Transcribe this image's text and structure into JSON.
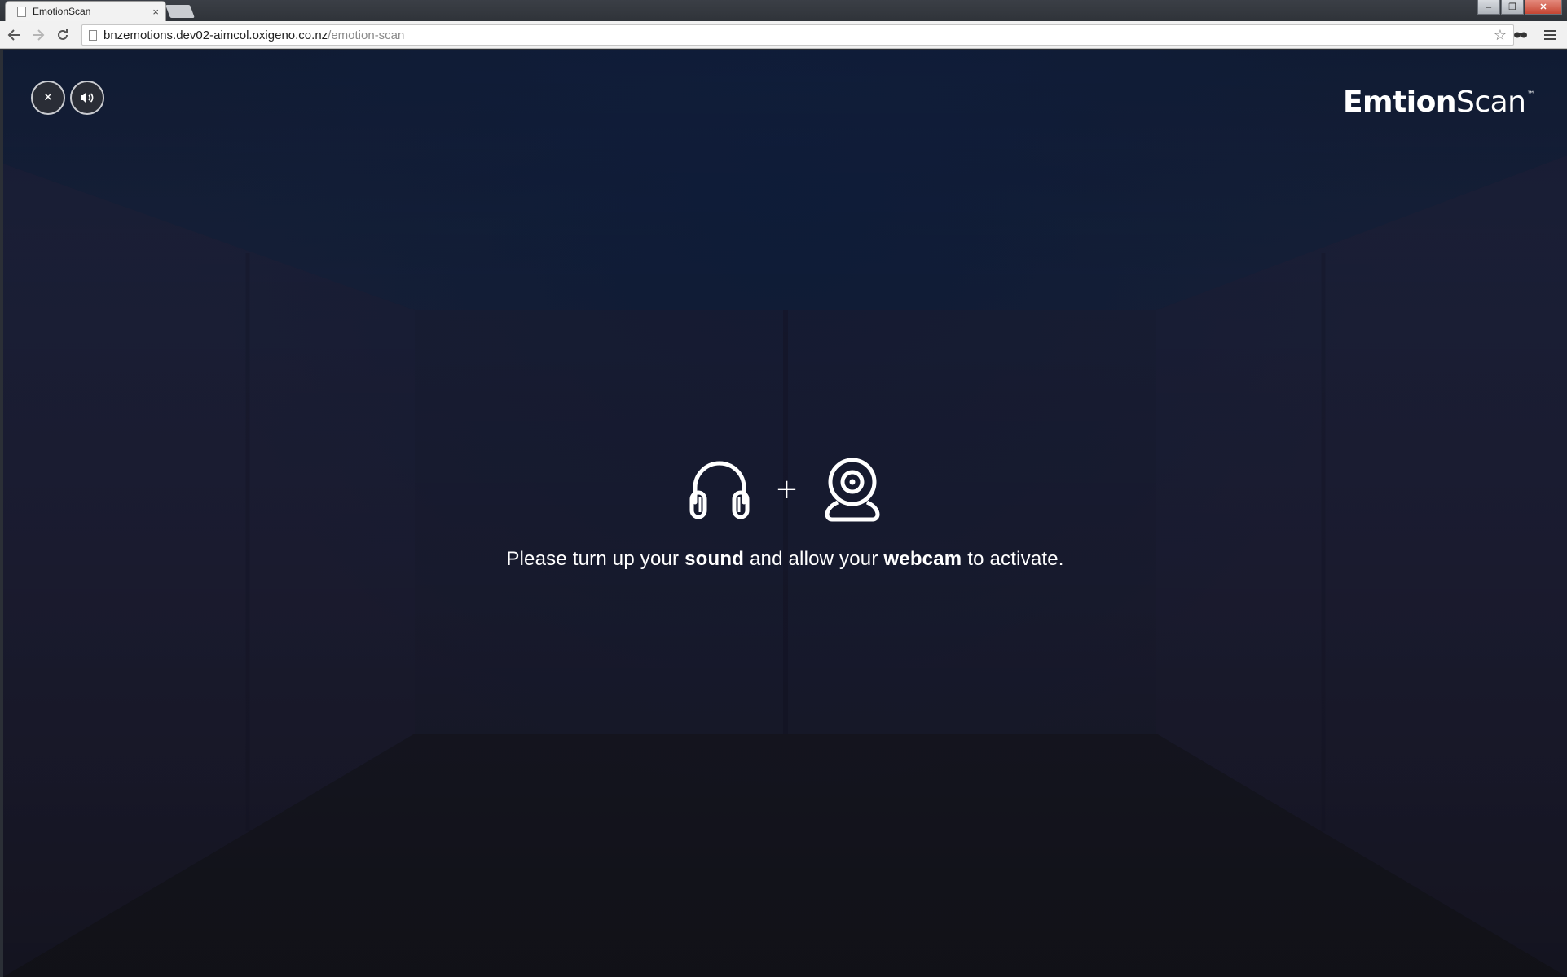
{
  "browser": {
    "tab_title": "EmotionScan",
    "tab_close_glyph": "×",
    "url_host": "bnzemotions.dev02-aimcol.oxigeno.co.nz",
    "url_path": "/emotion-scan",
    "window_controls": [
      "–",
      "❐",
      "✕"
    ]
  },
  "page": {
    "logo": {
      "part1": "Em",
      "part2": "tion",
      "part3": "Scan",
      "tm": "™"
    },
    "close_button_glyph": "✕",
    "instruction": {
      "pre": "Please turn up your ",
      "bold1": "sound",
      "mid": " and allow your ",
      "bold2": "webcam",
      "post": " to activate."
    },
    "plus_glyph": "+",
    "icons": [
      "headphones-icon",
      "webcam-icon",
      "speaker-icon",
      "close-icon"
    ]
  },
  "colors": {
    "background_top": "#101b33",
    "background_bottom": "#16171f",
    "text": "#ffffff"
  }
}
